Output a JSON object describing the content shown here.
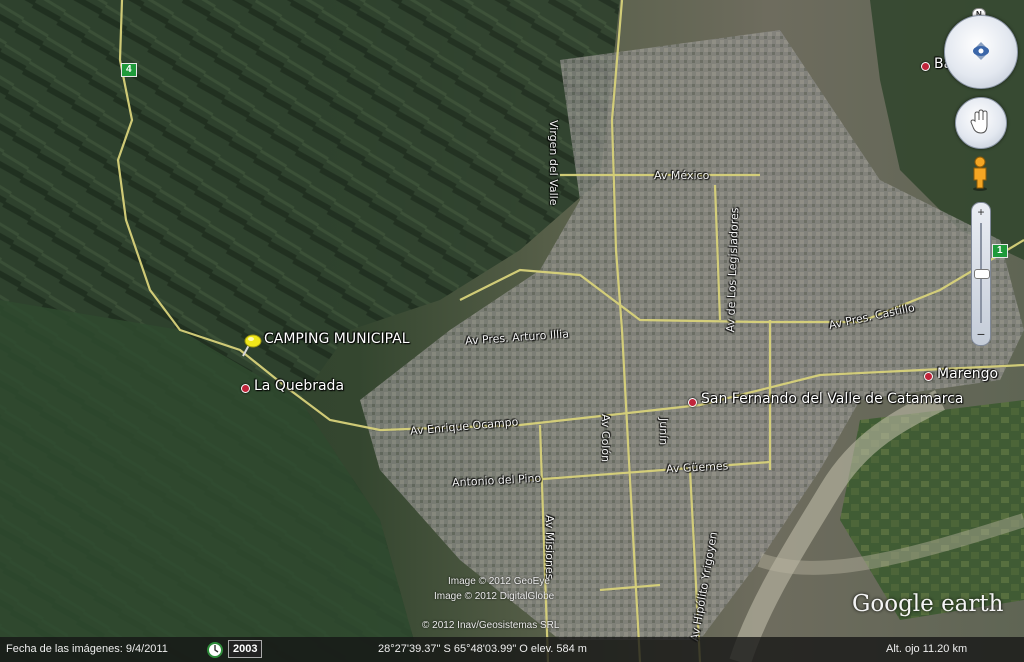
{
  "map": {
    "places": {
      "camping_municipal": "CAMPING MUNICIPAL",
      "la_quebrada": "La Quebrada",
      "san_fernando": "San Fernando del Valle de Catamarca",
      "marengo": "Marengo",
      "top_right_place": "Ba"
    },
    "roads": {
      "virgen_del_valle": "Virgen del Valle",
      "av_mexico": "Av México",
      "av_de_los_legisladores": "Av de Los Legisladores",
      "av_pres_arturo_illia": "Av Pres. Arturo Illia",
      "av_pres_castillo": "Av Pres. Castillo",
      "av_enrique_ocampo": "Av Enrique Ocampo",
      "antonio_del_pino": "Antonio del Pino",
      "av_guemes": "Av Güemes",
      "av_colon": "Av Colón",
      "junin": "Junín",
      "av_misiones": "Av Misiones",
      "av_hipolito_yrigoyen": "Av Hipólito Yrigoyen"
    },
    "route_shields": {
      "route_4": "4",
      "route_1": "1"
    },
    "copyrights": [
      "Image © 2012 GeoEye",
      "Image © 2012 DigitalGlobe",
      "© 2012 Inav/Geosistemas SRL"
    ],
    "logo": "Google earth"
  },
  "controls": {
    "north_label": "N"
  },
  "status": {
    "imagery_date": "Fecha de las imágenes: 9/4/2011",
    "year_button": "2003",
    "coordinates": "28°27'39.37\" S  65°48'03.99\" O elev.   584 m",
    "eye_alt": "Alt. ojo    11.20 km"
  },
  "colors": {
    "road": "#d8d27a",
    "pin": "#f0e81a",
    "status_bar": "#141414",
    "marker": "#c0243a"
  }
}
